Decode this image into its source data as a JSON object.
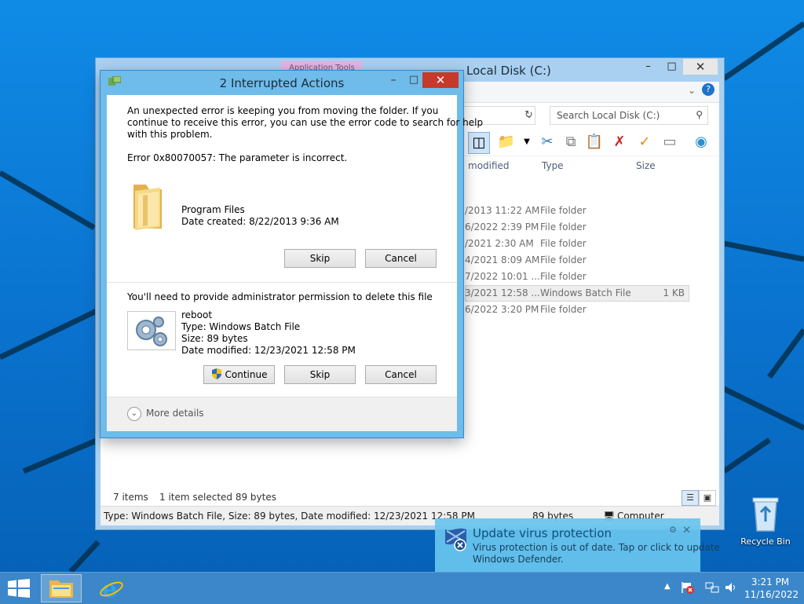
{
  "explorer": {
    "title": "Local Disk (C:)",
    "ribbon_context_tab": "Application Tools",
    "search_placeholder": "Search Local Disk (C:)",
    "columns": {
      "date": "modified",
      "type": "Type",
      "size": "Size"
    },
    "rows": [
      {
        "date": "/2013 11:22 AM",
        "type": "File folder",
        "size": ""
      },
      {
        "date": "6/2022 2:39 PM",
        "type": "File folder",
        "size": ""
      },
      {
        "date": "/2021 2:30 AM",
        "type": "File folder",
        "size": ""
      },
      {
        "date": "4/2021 8:09 AM",
        "type": "File folder",
        "size": ""
      },
      {
        "date": "7/2022 10:01 ...",
        "type": "File folder",
        "size": ""
      },
      {
        "date": "3/2021 12:58 ...",
        "type": "Windows Batch File",
        "size": "1 KB"
      },
      {
        "date": "6/2022 3:20 PM",
        "type": "File folder",
        "size": ""
      }
    ],
    "status": {
      "item_count": "7 items",
      "selection": "1 item selected  89 bytes",
      "details": "Type: Windows Batch File, Size: 89 bytes, Date modified: 12/23/2021 12:58 PM",
      "size": "89 bytes",
      "location": "Computer"
    }
  },
  "dialog": {
    "title": "2 Interrupted Actions",
    "message": [
      "An unexpected error is keeping you from moving the folder. If you",
      "continue to receive this error, you can use the error code to search for help",
      "with this problem."
    ],
    "error": "Error 0x80070057: The parameter is incorrect.",
    "item1": {
      "name": "Program Files",
      "created": "Date created: 8/22/2013 9:36 AM"
    },
    "item1_buttons": {
      "skip": "Skip",
      "cancel": "Cancel"
    },
    "admin_note": "You'll need to provide administrator permission to delete this file",
    "item2": {
      "name": "reboot",
      "type": "Type: Windows Batch File",
      "size": "Size: 89 bytes",
      "modified": "Date modified: 12/23/2021 12:58 PM"
    },
    "item2_buttons": {
      "continue": "Continue",
      "skip": "Skip",
      "cancel": "Cancel"
    },
    "more_details": "More details"
  },
  "toast": {
    "title": "Update virus protection",
    "lines": [
      "Virus protection is out of date. Tap or click to update",
      "Windows Defender."
    ]
  },
  "desktop": {
    "recycle_bin": "Recycle Bin"
  },
  "taskbar": {
    "time": "3:21 PM",
    "date": "11/16/2022"
  }
}
